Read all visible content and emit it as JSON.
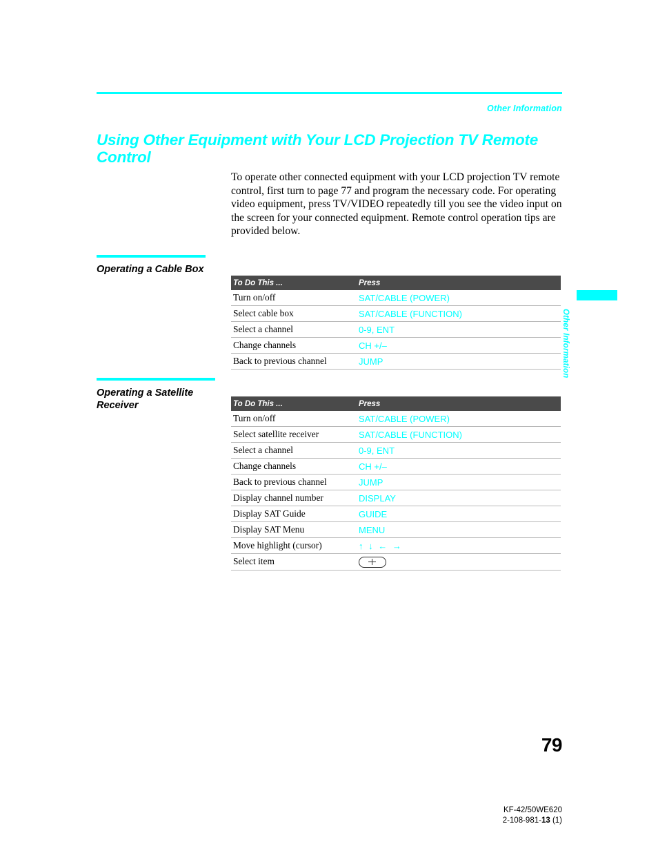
{
  "header": {
    "running_head": "Other Information",
    "chapter_title": "Using Other Equipment with Your LCD Projection TV Remote Control"
  },
  "intro": {
    "paragraph": "To operate other connected equipment with your LCD projection TV remote control, first turn to page 77 and program the necessary code. For operating video equipment, press TV/VIDEO repeatedly till you see the video input on the screen for your connected equipment. Remote control operation tips are provided below."
  },
  "sections": [
    {
      "heading": "Operating a Cable Box",
      "table": {
        "columns": [
          "To Do This ...",
          "Press"
        ],
        "rows": [
          {
            "todo": "Turn on/off",
            "press": "SAT/CABLE (POWER)",
            "type": "text"
          },
          {
            "todo": "Select cable box",
            "press": "SAT/CABLE (FUNCTION)",
            "type": "text"
          },
          {
            "todo": "Select a channel",
            "press": "0-9, ENT",
            "type": "text"
          },
          {
            "todo": "Change channels",
            "press": "CH +/–",
            "type": "text"
          },
          {
            "todo": "Back to previous channel",
            "press": "JUMP",
            "type": "text"
          }
        ]
      }
    },
    {
      "heading": "Operating a Satellite Receiver",
      "table": {
        "columns": [
          "To Do This ...",
          "Press"
        ],
        "rows": [
          {
            "todo": "Turn on/off",
            "press": "SAT/CABLE (POWER)",
            "type": "text"
          },
          {
            "todo": "Select satellite receiver",
            "press": "SAT/CABLE (FUNCTION)",
            "type": "text"
          },
          {
            "todo": "Select a channel",
            "press": "0-9, ENT",
            "type": "text"
          },
          {
            "todo": "Change channels",
            "press": "CH +/–",
            "type": "text"
          },
          {
            "todo": "Back to previous channel",
            "press": "JUMP",
            "type": "text"
          },
          {
            "todo": "Display channel number",
            "press": "DISPLAY",
            "type": "text"
          },
          {
            "todo": "Display SAT Guide",
            "press": "GUIDE",
            "type": "text"
          },
          {
            "todo": "Display SAT Menu",
            "press": "MENU",
            "type": "text"
          },
          {
            "todo": "Move highlight (cursor)",
            "press": "↑ ↓ ← →",
            "type": "arrows"
          },
          {
            "todo": "Select item",
            "press": "",
            "type": "pill-button"
          }
        ]
      }
    }
  ],
  "side_tab": {
    "label": "Other Information"
  },
  "footer": {
    "page_number": "79",
    "model": "KF-42/50WE620",
    "doc_number_prefix": "2-108-981-",
    "doc_number_bold": "13",
    "doc_number_suffix": " (1)"
  },
  "colors": {
    "accent_cyan": "#00ffff",
    "table_header_gray": "#4a4a4a",
    "rule_gray": "#b8b8b8",
    "text_black": "#000000"
  }
}
